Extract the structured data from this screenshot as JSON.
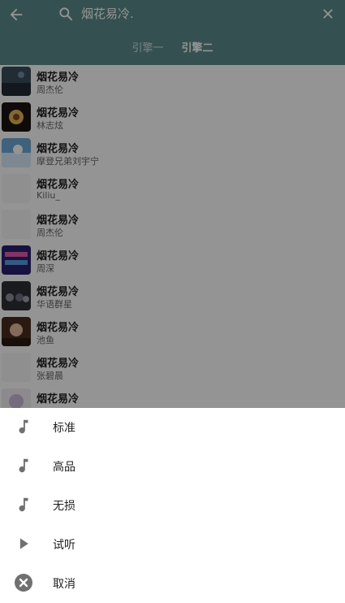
{
  "header": {
    "query": "烟花易冷.",
    "tabs": [
      {
        "label": "引擎一",
        "active": false
      },
      {
        "label": "引擎二",
        "active": true
      }
    ],
    "icons": {
      "back": "back-arrow-icon",
      "search": "search-icon",
      "clear": "close-icon"
    }
  },
  "results": [
    {
      "title": "烟花易冷",
      "artist": "周杰伦"
    },
    {
      "title": "烟花易冷",
      "artist": "林志炫"
    },
    {
      "title": "烟花易冷",
      "artist": "摩登兄弟刘宇宁"
    },
    {
      "title": "烟花易冷",
      "artist": "Kiliu_"
    },
    {
      "title": "烟花易冷",
      "artist": "周杰伦"
    },
    {
      "title": "烟花易冷",
      "artist": "周深"
    },
    {
      "title": "烟花易冷",
      "artist": "华语群星"
    },
    {
      "title": "烟花易冷",
      "artist": "池鱼"
    },
    {
      "title": "烟花易冷",
      "artist": "张碧晨"
    },
    {
      "title": "烟花易冷",
      "artist": ""
    }
  ],
  "sheet": {
    "options": [
      {
        "label": "标准",
        "icon": "music-note-icon"
      },
      {
        "label": "高品",
        "icon": "music-note-icon"
      },
      {
        "label": "无损",
        "icon": "music-note-icon"
      },
      {
        "label": "试听",
        "icon": "play-icon"
      },
      {
        "label": "取消",
        "icon": "cancel-icon"
      }
    ]
  },
  "colors": {
    "header": "#5c8a8a",
    "overlay": "rgba(0,0,0,0.42)",
    "icon": "#707070"
  }
}
